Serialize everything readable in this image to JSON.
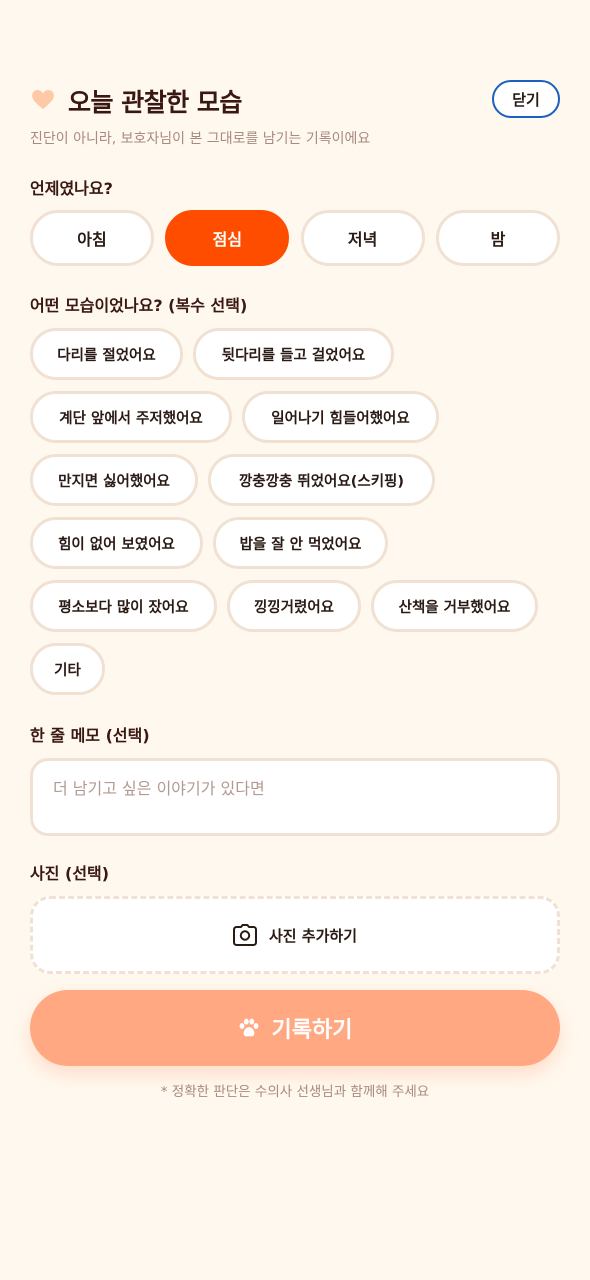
{
  "header": {
    "title": "오늘 관찰한 모습",
    "close_label": "닫기",
    "subtitle": "진단이 아니라, 보호자님이 본 그대로를 남기는 기록이에요"
  },
  "when": {
    "label": "언제였나요?",
    "options": [
      "아침",
      "점심",
      "저녁",
      "밤"
    ],
    "selected": "점심"
  },
  "observations": {
    "label": "어떤 모습이었나요? (복수 선택)",
    "chips": [
      "다리를 절었어요",
      "뒷다리를 들고 걸었어요",
      "계단 앞에서 주저했어요",
      "일어나기 힘들어했어요",
      "만지면 싫어했어요",
      "깡충깡충 뛰었어요(스키핑)",
      "힘이 없어 보였어요",
      "밥을 잘 안 먹었어요",
      "평소보다 많이 잤어요",
      "낑낑거렸어요",
      "산책을 거부했어요",
      "기타"
    ]
  },
  "memo": {
    "label": "한 줄 메모 (선택)",
    "placeholder": "더 남기고 싶은 이야기가 있다면",
    "value": ""
  },
  "photo": {
    "label": "사진 (선택)",
    "add_label": "사진 추가하기",
    "icon": "camera-icon"
  },
  "submit": {
    "label": "기록하기",
    "icon": "paw-icon"
  },
  "footer": {
    "note": "* 정확한 판단은 수의사 선생님과 함께해 주세요"
  },
  "colors": {
    "background": "#fff8ee",
    "accent": "#ff4d00",
    "submit": "#ffa882",
    "border": "#f1e1d3",
    "close_border": "#1b5fbf",
    "heart": "#ffc9a8"
  }
}
